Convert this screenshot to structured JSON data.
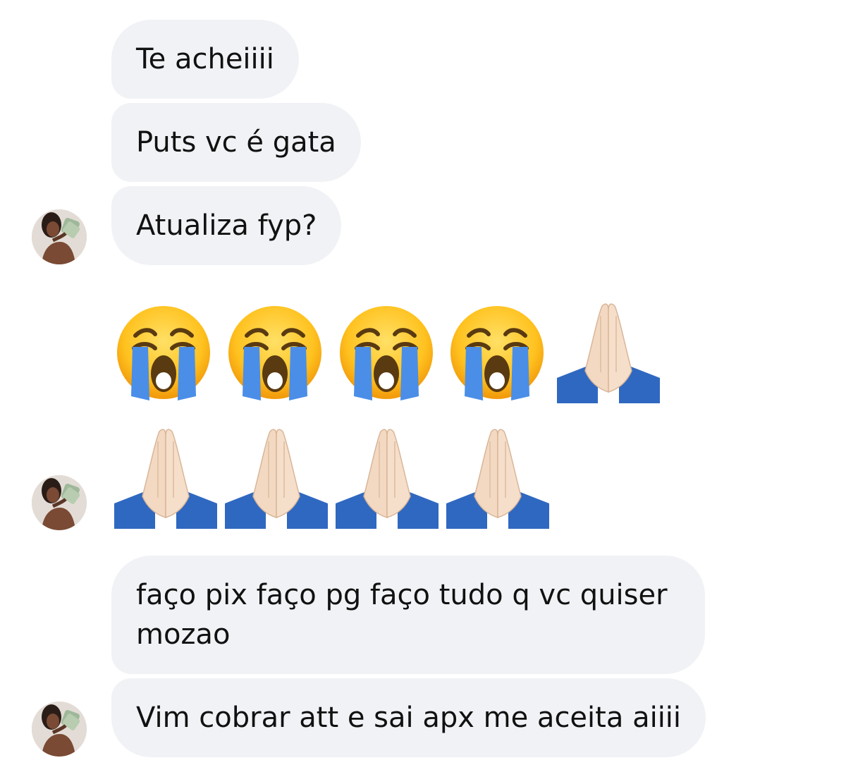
{
  "conversation": {
    "messages": [
      {
        "text": "Te acheiiii"
      },
      {
        "text": "Puts vc é gata"
      },
      {
        "text": "Atualiza fyp?"
      },
      {
        "text": "faço pix faço pg faço tudo q vc quiser mozao"
      },
      {
        "text": "Vim cobrar att e sai apx me aceita aiiii"
      }
    ],
    "emoji_messages": [
      {
        "icons": [
          "loudly-crying-face-icon",
          "loudly-crying-face-icon",
          "loudly-crying-face-icon",
          "loudly-crying-face-icon",
          "folded-hands-icon"
        ]
      },
      {
        "icons": [
          "folded-hands-icon",
          "folded-hands-icon",
          "folded-hands-icon",
          "folded-hands-icon"
        ]
      }
    ]
  },
  "colors": {
    "bubble_background": "#f1f2f5",
    "text": "#111111",
    "page_background": "#ffffff"
  }
}
